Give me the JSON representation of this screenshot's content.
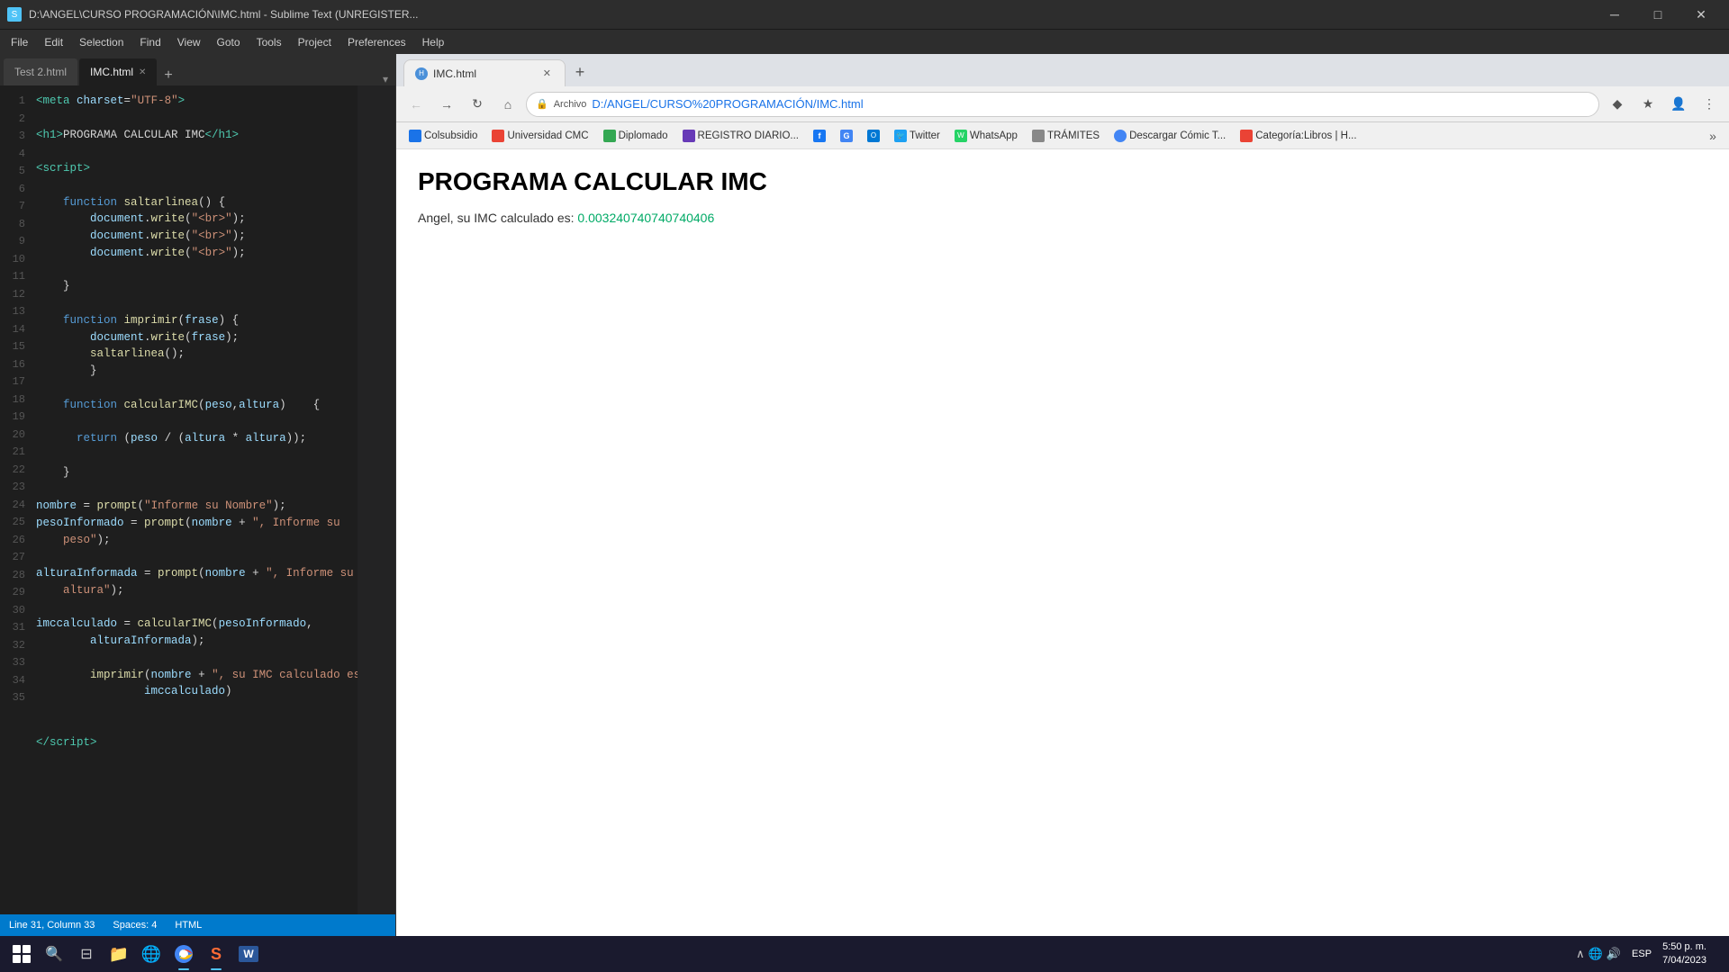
{
  "titleBar": {
    "title": "D:\\ANGEL\\CURSO PROGRAMACIÓN\\IMC.html - Sublime Text (UNREGISTER...",
    "minimize": "─",
    "maximize": "□",
    "close": "✕"
  },
  "menuBar": {
    "items": [
      "File",
      "Edit",
      "Selection",
      "Find",
      "View",
      "Goto",
      "Tools",
      "Project",
      "Preferences",
      "Help"
    ]
  },
  "editor": {
    "tabs": [
      {
        "label": "Test 2.html",
        "active": false
      },
      {
        "label": "IMC.html",
        "active": true
      }
    ],
    "lines": [
      {
        "num": 1,
        "code": "<meta_charset>"
      },
      {
        "num": 2,
        "code": ""
      },
      {
        "num": 3,
        "code": "h1_imc"
      },
      {
        "num": 4,
        "code": ""
      },
      {
        "num": 5,
        "code": "script_open"
      },
      {
        "num": 6,
        "code": ""
      },
      {
        "num": 7,
        "code": "fn_saltarlinea_open"
      },
      {
        "num": 8,
        "code": "doc_write_br1"
      },
      {
        "num": 9,
        "code": "doc_write_br2"
      },
      {
        "num": 10,
        "code": "doc_write_br3"
      },
      {
        "num": 11,
        "code": ""
      },
      {
        "num": 12,
        "code": "fn_close"
      },
      {
        "num": 13,
        "code": ""
      },
      {
        "num": 14,
        "code": "fn_imprimir_open"
      },
      {
        "num": 15,
        "code": "doc_write_frase"
      },
      {
        "num": 16,
        "code": "saltarlinea_call"
      },
      {
        "num": 17,
        "code": "fn_inner_close"
      },
      {
        "num": 18,
        "code": ""
      },
      {
        "num": 19,
        "code": "fn_calcularIMC_open"
      },
      {
        "num": 20,
        "code": ""
      },
      {
        "num": 21,
        "code": "return_stmt"
      },
      {
        "num": 22,
        "code": ""
      },
      {
        "num": 23,
        "code": "fn_close2"
      },
      {
        "num": 24,
        "code": ""
      },
      {
        "num": 25,
        "code": "nombre_prompt"
      },
      {
        "num": 26,
        "code": "pesoInformado_prompt1"
      },
      {
        "num": 27,
        "code": "pesoInformado_prompt2"
      },
      {
        "num": 28,
        "code": ""
      },
      {
        "num": 29,
        "code": "alturaInformada_prompt1"
      },
      {
        "num": 30,
        "code": "alturaInformada_prompt2"
      },
      {
        "num": 31,
        "code": ""
      },
      {
        "num": 32,
        "code": ""
      },
      {
        "num": 33,
        "code": "imccalculado_assign1"
      },
      {
        "num": 34,
        "code": "imccalculado_assign2"
      },
      {
        "num": 35,
        "code": ""
      }
    ],
    "status": {
      "position": "Line 31, Column 33",
      "spaces": "Spaces: 4",
      "syntax": "HTML"
    }
  },
  "browser": {
    "tabs": [
      {
        "label": "IMC.html"
      }
    ],
    "addressBar": {
      "protocol": "Archivo",
      "url": "D:/ANGEL/CURSO%20PROGRAMACIÓN/IMC.html"
    },
    "bookmarks": [
      {
        "label": "Colsubsidio",
        "color": "blue"
      },
      {
        "label": "Universidad CMC",
        "color": "red"
      },
      {
        "label": "Diplomado",
        "color": "green"
      },
      {
        "label": "REGISTRO DIARIO...",
        "color": "purple"
      },
      {
        "label": "",
        "color": "fb"
      },
      {
        "label": "",
        "color": "g"
      },
      {
        "label": "",
        "color": "outlook"
      },
      {
        "label": "Twitter",
        "color": "twitter"
      },
      {
        "label": "WhatsApp",
        "color": "wa"
      },
      {
        "label": "TRÁMITES",
        "color": "blue"
      },
      {
        "label": "Descargar Cómic T...",
        "color": "chrome"
      },
      {
        "label": "Categoría:Libros | H...",
        "color": "red"
      }
    ],
    "page": {
      "heading": "PROGRAMA CALCULAR IMC",
      "body": "Angel, su IMC calculado es: 0.003240740740740406"
    }
  },
  "taskbar": {
    "apps": [
      {
        "icon": "⊞",
        "name": "start"
      },
      {
        "icon": "🔍",
        "name": "search"
      },
      {
        "icon": "⊟",
        "name": "taskview"
      },
      {
        "icon": "📁",
        "name": "explorer"
      },
      {
        "icon": "🌐",
        "name": "chrome",
        "active": true
      },
      {
        "icon": "⬛",
        "name": "sublime",
        "active": true
      },
      {
        "icon": "W",
        "name": "word"
      }
    ],
    "clock": {
      "time": "5:50 p. m.",
      "date": "7/04/2023"
    },
    "language": "ESP"
  }
}
